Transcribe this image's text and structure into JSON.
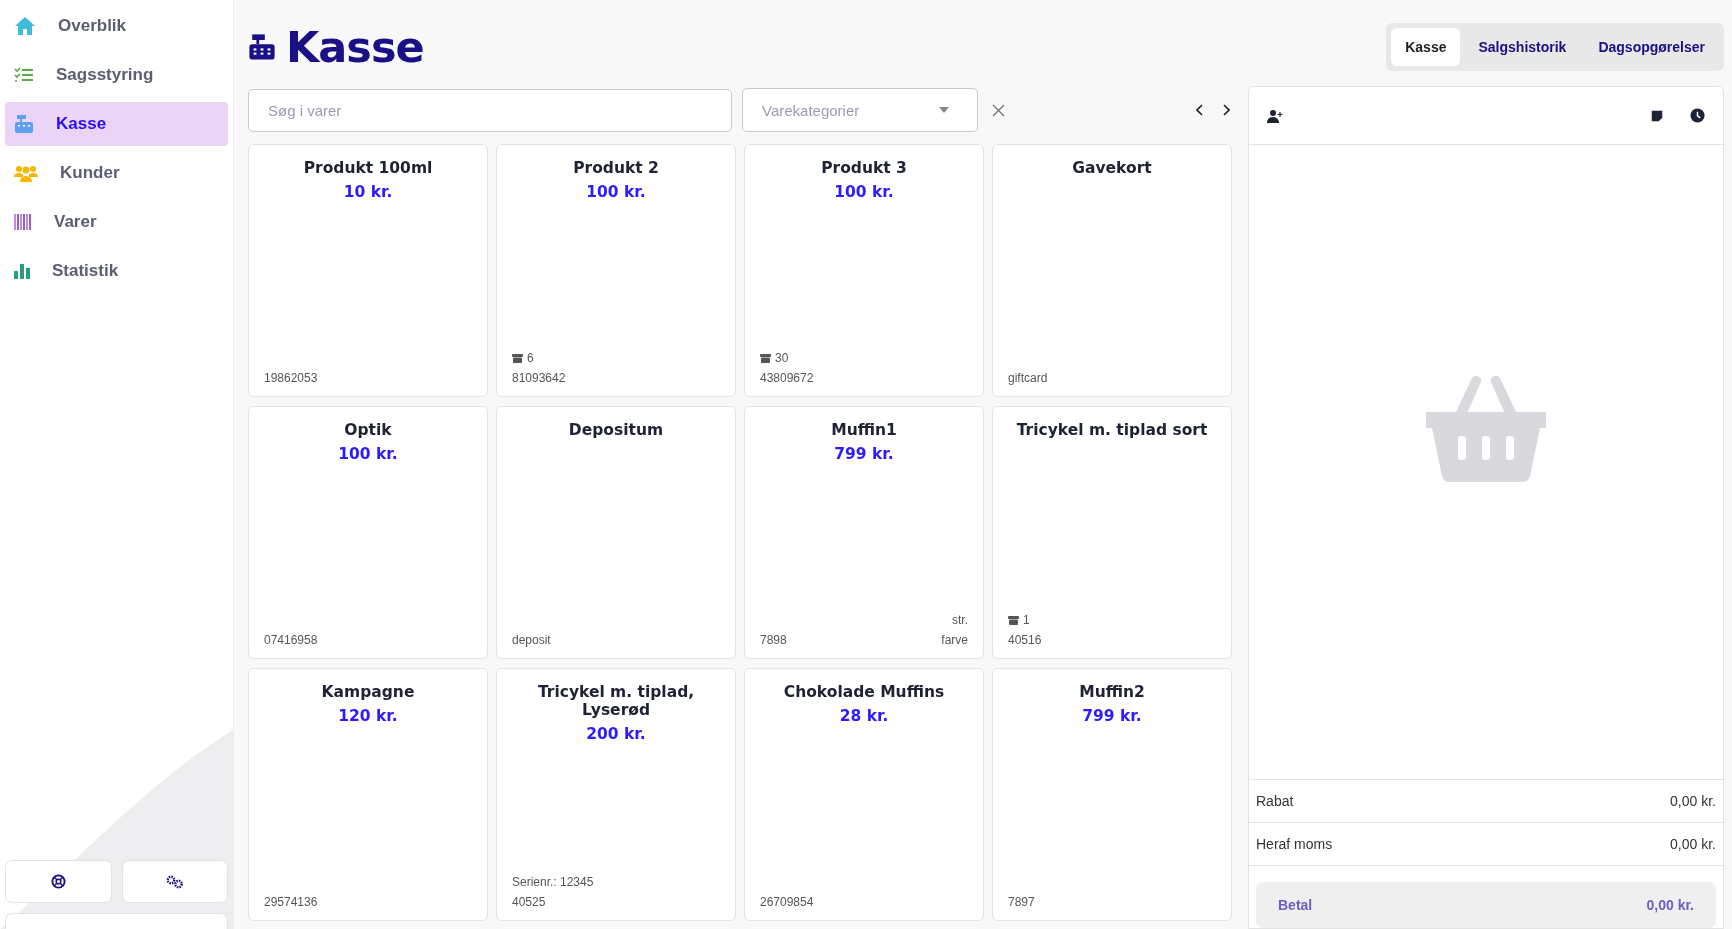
{
  "sidebar": {
    "items": [
      {
        "label": "Overblik",
        "selected": false
      },
      {
        "label": "Sagsstyring",
        "selected": false
      },
      {
        "label": "Kasse",
        "selected": true
      },
      {
        "label": "Kunder",
        "selected": false
      },
      {
        "label": "Varer",
        "selected": false
      },
      {
        "label": "Statistik",
        "selected": false
      }
    ]
  },
  "page": {
    "title": "Kasse"
  },
  "tabs": [
    {
      "label": "Kasse",
      "selected": true
    },
    {
      "label": "Salgshistorik",
      "selected": false
    },
    {
      "label": "Dagsopgørelser",
      "selected": false
    }
  ],
  "search": {
    "placeholder": "Søg i varer"
  },
  "category_select": {
    "placeholder": "Varekategorier"
  },
  "products": [
    {
      "name": "Produkt 100ml",
      "price": "10 kr.",
      "code": "19862053"
    },
    {
      "name": "Produkt 2",
      "price": "100 kr.",
      "stock": "6",
      "code": "81093642"
    },
    {
      "name": "Produkt 3",
      "price": "100 kr.",
      "stock": "30",
      "code": "43809672"
    },
    {
      "name": "Gavekort",
      "code": "giftcard"
    },
    {
      "name": "Optik",
      "price": "100 kr.",
      "code": "07416958"
    },
    {
      "name": "Depositum",
      "code": "deposit"
    },
    {
      "name": "Muffin1",
      "price": "799 kr.",
      "code": "7898",
      "attributes": [
        "str.",
        "farve"
      ]
    },
    {
      "name": "Tricykel m. tiplad sort",
      "stock": "1",
      "code": "40516"
    },
    {
      "name": "Kampagne",
      "price": "120 kr.",
      "code": "29574136"
    },
    {
      "name": "Tricykel m. tiplad, Lyserød",
      "price": "200 kr.",
      "serial": "Serienr.: 12345",
      "code": "40525"
    },
    {
      "name": "Chokolade Muffins",
      "price": "28 kr.",
      "code": "26709854"
    },
    {
      "name": "Muffin2",
      "price": "799 kr.",
      "code": "7897"
    }
  ],
  "cart": {
    "summary": [
      {
        "label": "Rabat",
        "value": "0,00 kr."
      },
      {
        "label": "Heraf moms",
        "value": "0,00 kr."
      }
    ],
    "pay": {
      "label": "Betal",
      "value": "0,00 kr."
    }
  }
}
